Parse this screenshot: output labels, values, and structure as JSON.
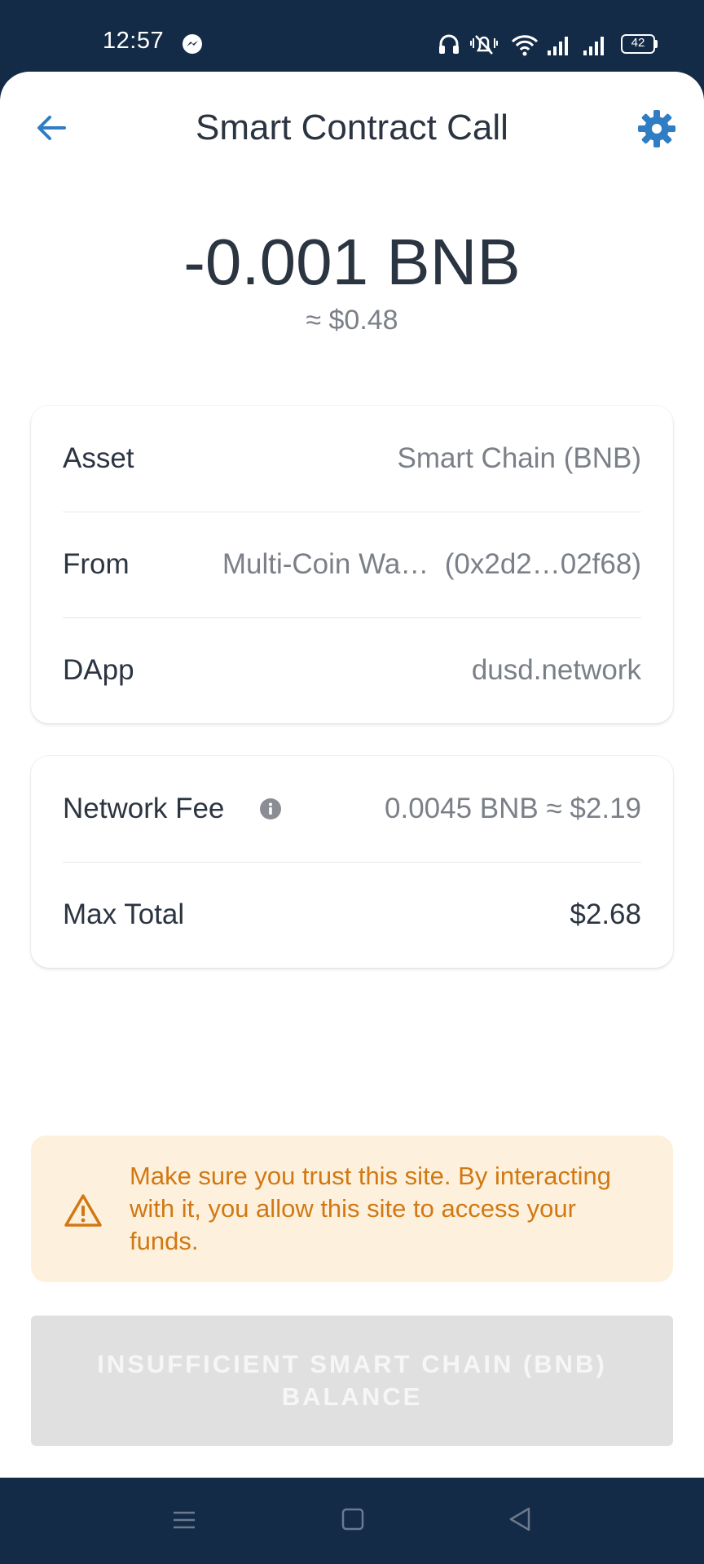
{
  "status_bar": {
    "time": "12:57",
    "battery": "42",
    "icons": [
      "messenger-icon",
      "headset-icon",
      "mute-icon",
      "wifi-icon",
      "signal-icon",
      "signal-icon",
      "battery-icon"
    ]
  },
  "header": {
    "title": "Smart Contract Call",
    "back_icon": "arrow-left-icon",
    "settings_icon": "gear-icon"
  },
  "amount": {
    "value": "-0.001 BNB",
    "usd": "≈ $0.48"
  },
  "details": [
    {
      "label": "Asset",
      "value": "Smart Chain (BNB)"
    },
    {
      "label": "From",
      "value": "Multi-Coin Wa…  (0x2d2…02f68)"
    },
    {
      "label": "DApp",
      "value": "dusd.network"
    }
  ],
  "fee": {
    "network_fee_label": "Network Fee",
    "network_fee_value": "0.0045 BNB ≈ $2.19",
    "max_total_label": "Max Total",
    "max_total_value": "$2.68"
  },
  "warning": {
    "text": "Make sure you trust this site. By interacting with it, you allow this site to access your funds."
  },
  "action": {
    "label": "INSUFFICIENT SMART CHAIN (BNB) BALANCE"
  },
  "colors": {
    "accent": "#2f7dc2",
    "status_bg": "#142b47",
    "warning_bg": "#fdf1de",
    "warning_text": "#d27812",
    "disabled_button": "#e0e0e0"
  },
  "nav": {
    "icons": [
      "menu-icon",
      "home-square-icon",
      "back-triangle-icon"
    ]
  }
}
